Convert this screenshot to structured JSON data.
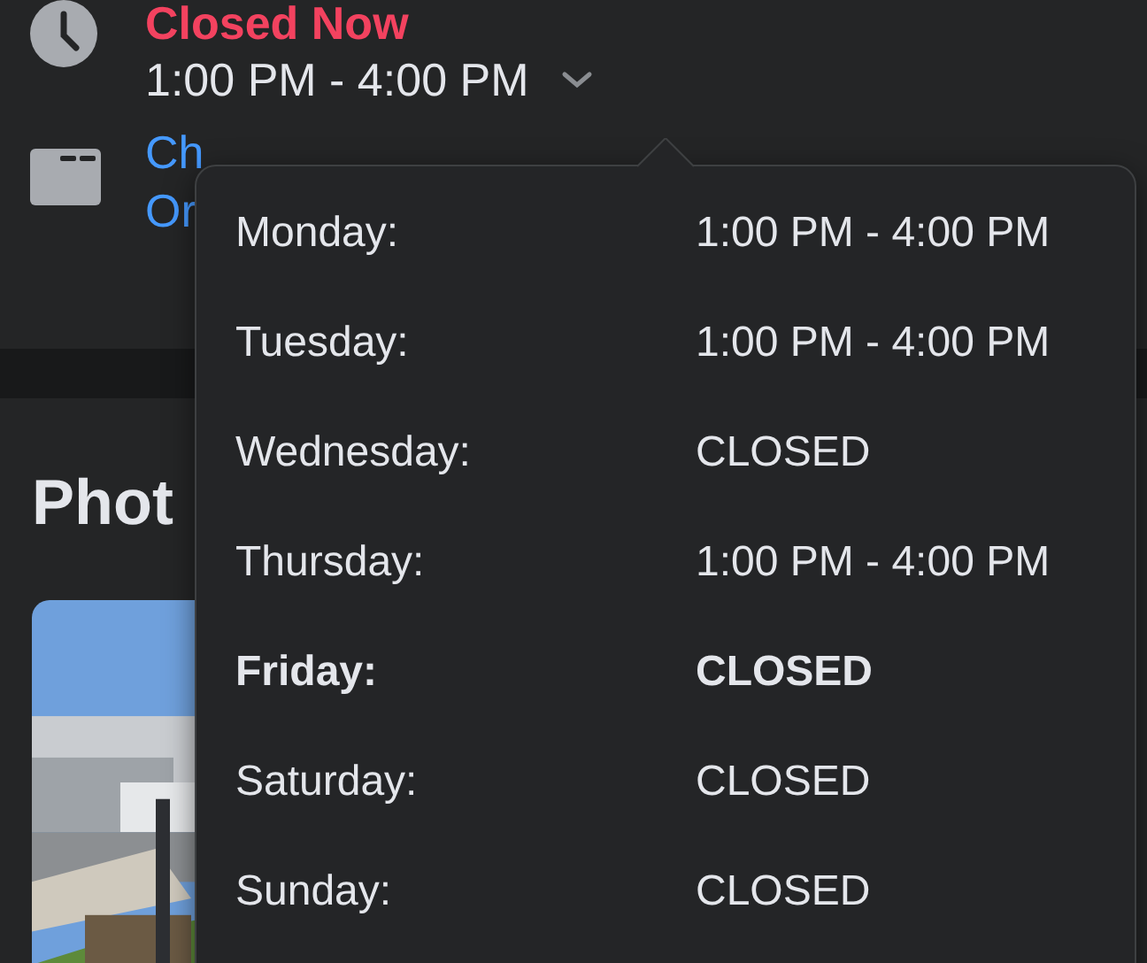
{
  "hours": {
    "status": "Closed Now",
    "today": "1:00 PM - 4:00 PM",
    "expanded": true
  },
  "category": {
    "lines": [
      "Ch",
      "Or"
    ]
  },
  "photos": {
    "title": "Phot"
  },
  "schedule": [
    {
      "day": "Monday:",
      "hours": "1:00 PM - 4:00 PM",
      "today": false
    },
    {
      "day": "Tuesday:",
      "hours": "1:00 PM - 4:00 PM",
      "today": false
    },
    {
      "day": "Wednesday:",
      "hours": "CLOSED",
      "today": false
    },
    {
      "day": "Thursday:",
      "hours": "1:00 PM - 4:00 PM",
      "today": false
    },
    {
      "day": "Friday:",
      "hours": "CLOSED",
      "today": true
    },
    {
      "day": "Saturday:",
      "hours": "CLOSED",
      "today": false
    },
    {
      "day": "Sunday:",
      "hours": "CLOSED",
      "today": false
    }
  ]
}
